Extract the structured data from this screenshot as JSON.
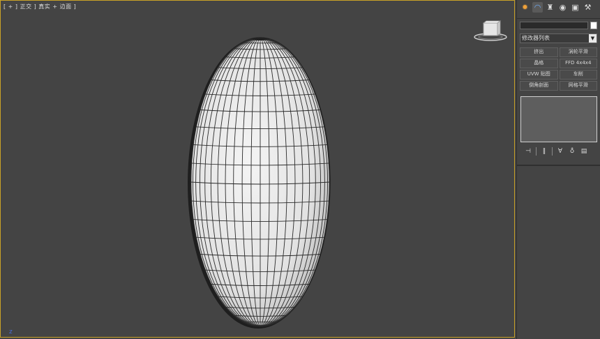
{
  "viewport": {
    "label": "[ + ] 正交 ] 真实 + 边面 ]",
    "border_color": "#c9a227",
    "background": "#444444",
    "mesh_object": "ellipsoid-sphere",
    "axis_mark": "z"
  },
  "command_panel": {
    "tabs": [
      {
        "name": "create",
        "icon": "sun-icon",
        "glyph": "✹"
      },
      {
        "name": "modify",
        "icon": "modify-arc-icon",
        "glyph": "◠"
      },
      {
        "name": "hierarchy",
        "icon": "hierarchy-icon",
        "glyph": "♜"
      },
      {
        "name": "motion",
        "icon": "motion-icon",
        "glyph": "◉"
      },
      {
        "name": "display",
        "icon": "display-icon",
        "glyph": "▣"
      },
      {
        "name": "utilities",
        "icon": "wrench-icon",
        "glyph": "⚒"
      }
    ],
    "object_name": "",
    "modifier_list_label": "修改器列表",
    "modifier_buttons": [
      "挤出",
      "涡轮平滑",
      "晶格",
      "FFD 4x4x4",
      "UVW 贴图",
      "车削",
      "倒角剖面",
      "网格平滑"
    ],
    "stack_tools": [
      {
        "icon": "pin-stack-icon",
        "glyph": "⊣"
      },
      {
        "icon": "show-end-result-icon",
        "glyph": "‖"
      },
      {
        "icon": "make-unique-icon",
        "glyph": "∀"
      },
      {
        "icon": "remove-modifier-icon",
        "glyph": "♁"
      },
      {
        "icon": "configure-sets-icon",
        "glyph": "▤"
      }
    ]
  }
}
